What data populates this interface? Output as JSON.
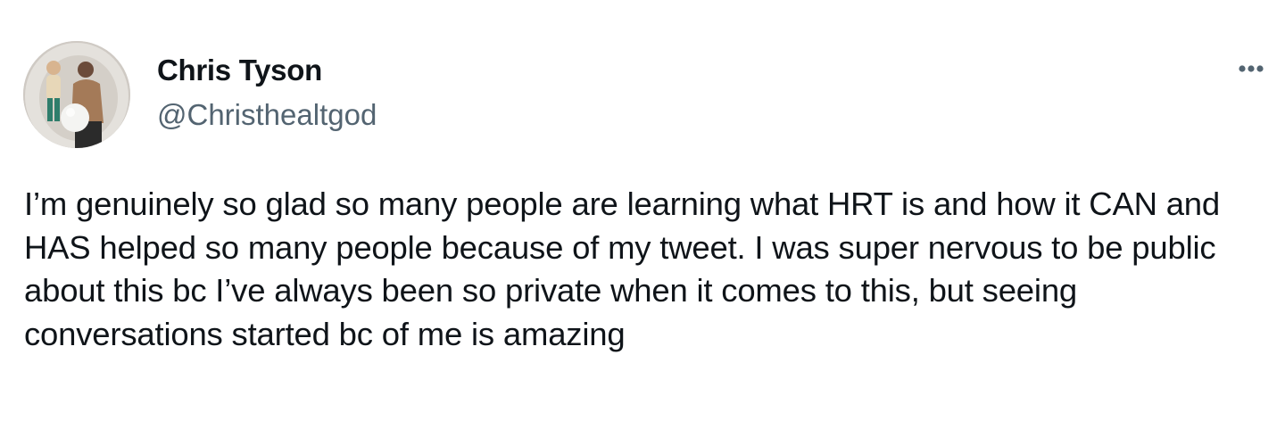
{
  "author": {
    "name": "Chris Tyson",
    "handle": "@Christhealtgod"
  },
  "avatar": {
    "icon": "avatar-photo"
  },
  "more_button": {
    "icon": "more-horizontal-icon"
  },
  "tweet": {
    "text": "I’m genuinely so glad so many people are learning what HRT is and how it CAN and HAS helped so many people because of my tweet. I was super nervous to be public about this bc I’ve always been so private when it comes to this, but seeing conversations started bc of me is amazing"
  },
  "colors": {
    "text_primary": "#0f1419",
    "text_secondary": "#536471",
    "background": "#ffffff"
  }
}
